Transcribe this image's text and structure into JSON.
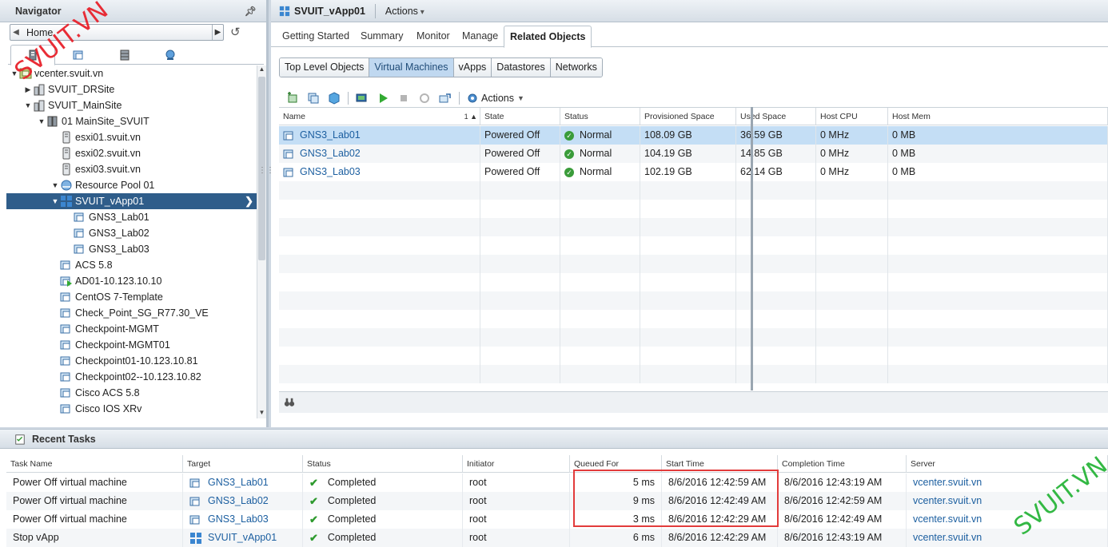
{
  "navigator": {
    "title": "Navigator",
    "home_label": "Home",
    "tree": [
      {
        "label": "vcenter.svuit.vn",
        "indent": 0,
        "twisty": "open",
        "icon": "vcenter-icon"
      },
      {
        "label": "SVUIT_DRSite",
        "indent": 1,
        "twisty": "closed",
        "icon": "datacenter-icon"
      },
      {
        "label": "SVUIT_MainSite",
        "indent": 1,
        "twisty": "open",
        "icon": "datacenter-icon"
      },
      {
        "label": "01 MainSite_SVUIT",
        "indent": 2,
        "twisty": "open",
        "icon": "cluster-icon"
      },
      {
        "label": "esxi01.svuit.vn",
        "indent": 3,
        "twisty": "",
        "icon": "host-icon"
      },
      {
        "label": "esxi02.svuit.vn",
        "indent": 3,
        "twisty": "",
        "icon": "host-icon"
      },
      {
        "label": "esxi03.svuit.vn",
        "indent": 3,
        "twisty": "",
        "icon": "host-icon"
      },
      {
        "label": "Resource Pool 01",
        "indent": 3,
        "twisty": "open",
        "icon": "resource-pool-icon"
      },
      {
        "label": "SVUIT_vApp01",
        "indent": 3,
        "twisty": "open",
        "icon": "vapp-icon",
        "selected": true
      },
      {
        "label": "GNS3_Lab01",
        "indent": 4,
        "twisty": "",
        "icon": "vm-icon"
      },
      {
        "label": "GNS3_Lab02",
        "indent": 4,
        "twisty": "",
        "icon": "vm-icon"
      },
      {
        "label": "GNS3_Lab03",
        "indent": 4,
        "twisty": "",
        "icon": "vm-icon"
      },
      {
        "label": "ACS 5.8",
        "indent": 3,
        "twisty": "",
        "icon": "vm-icon"
      },
      {
        "label": "AD01-10.123.10.10",
        "indent": 3,
        "twisty": "",
        "icon": "vm-on-icon"
      },
      {
        "label": "CentOS 7-Template",
        "indent": 3,
        "twisty": "",
        "icon": "vm-icon"
      },
      {
        "label": "Check_Point_SG_R77.30_VE",
        "indent": 3,
        "twisty": "",
        "icon": "vm-icon"
      },
      {
        "label": "Checkpoint-MGMT",
        "indent": 3,
        "twisty": "",
        "icon": "vm-icon"
      },
      {
        "label": "Checkpoint-MGMT01",
        "indent": 3,
        "twisty": "",
        "icon": "vm-icon"
      },
      {
        "label": "Checkpoint01-10.123.10.81",
        "indent": 3,
        "twisty": "",
        "icon": "vm-icon"
      },
      {
        "label": "Checkpoint02--10.123.10.82",
        "indent": 3,
        "twisty": "",
        "icon": "vm-icon"
      },
      {
        "label": "Cisco ACS 5.8",
        "indent": 3,
        "twisty": "",
        "icon": "vm-icon"
      },
      {
        "label": "Cisco IOS XRv",
        "indent": 3,
        "twisty": "",
        "icon": "vm-icon"
      }
    ]
  },
  "object": {
    "title": "SVUIT_vApp01",
    "actions_label": "Actions"
  },
  "tabs": [
    "Getting Started",
    "Summary",
    "Monitor",
    "Manage",
    "Related Objects"
  ],
  "active_tab": "Related Objects",
  "subtabs": [
    "Top Level Objects",
    "Virtual Machines",
    "vApps",
    "Datastores",
    "Networks"
  ],
  "active_subtab": "Virtual Machines",
  "toolbar": {
    "actions_label": "Actions"
  },
  "vm_table": {
    "columns": [
      "Name",
      "State",
      "Status",
      "Provisioned Space",
      "Used Space",
      "Host CPU",
      "Host Mem"
    ],
    "sort_indicator": "1 ▲",
    "rows": [
      {
        "name": "GNS3_Lab01",
        "state": "Powered Off",
        "status": "Normal",
        "provisioned": "108.09  GB",
        "used": "36.59  GB",
        "cpu": "0 MHz",
        "mem": "0 MB",
        "selected": true
      },
      {
        "name": "GNS3_Lab02",
        "state": "Powered Off",
        "status": "Normal",
        "provisioned": "104.19  GB",
        "used": "14.85  GB",
        "cpu": "0 MHz",
        "mem": "0 MB"
      },
      {
        "name": "GNS3_Lab03",
        "state": "Powered Off",
        "status": "Normal",
        "provisioned": "102.19  GB",
        "used": "62.14  GB",
        "cpu": "0 MHz",
        "mem": "0 MB"
      }
    ]
  },
  "tasks": {
    "title": "Recent Tasks",
    "columns": [
      "Task Name",
      "Target",
      "Status",
      "Initiator",
      "Queued For",
      "Start Time",
      "Completion Time",
      "Server"
    ],
    "rows": [
      {
        "task": "Power Off virtual machine",
        "target": "GNS3_Lab01",
        "target_icon": "vm-icon",
        "status": "Completed",
        "initiator": "root",
        "queued": "5 ms",
        "start": "8/6/2016 12:42:59 AM",
        "completion": "8/6/2016 12:43:19 AM",
        "server": "vcenter.svuit.vn"
      },
      {
        "task": "Power Off virtual machine",
        "target": "GNS3_Lab02",
        "target_icon": "vm-icon",
        "status": "Completed",
        "initiator": "root",
        "queued": "9 ms",
        "start": "8/6/2016 12:42:49 AM",
        "completion": "8/6/2016 12:42:59 AM",
        "server": "vcenter.svuit.vn"
      },
      {
        "task": "Power Off virtual machine",
        "target": "GNS3_Lab03",
        "target_icon": "vm-icon",
        "status": "Completed",
        "initiator": "root",
        "queued": "3 ms",
        "start": "8/6/2016 12:42:29 AM",
        "completion": "8/6/2016 12:42:49 AM",
        "server": "vcenter.svuit.vn"
      },
      {
        "task": "Stop vApp",
        "target": "SVUIT_vApp01",
        "target_icon": "vapp-icon",
        "status": "Completed",
        "initiator": "root",
        "queued": "6 ms",
        "start": "8/6/2016 12:42:29 AM",
        "completion": "8/6/2016 12:43:19 AM",
        "server": "vcenter.svuit.vn"
      }
    ]
  },
  "watermark": "SVUIT.VN",
  "colors": {
    "accent": "#2f5d8a",
    "selected_row": "#c4def5",
    "link": "#1c5fa0",
    "watermark_red": "#e8222c",
    "watermark_green": "#29b53a",
    "highlight_box": "#e23b3b"
  }
}
